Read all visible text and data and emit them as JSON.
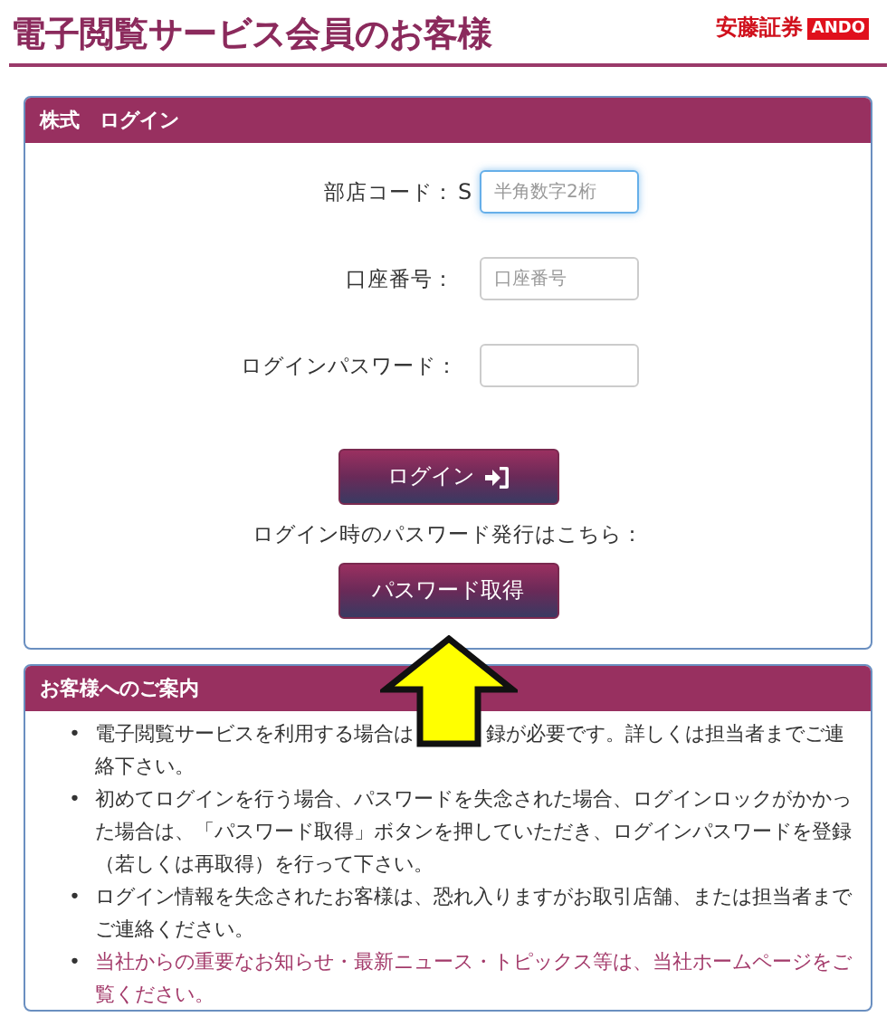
{
  "header": {
    "title": "電子閲覧サービス会員のお客様",
    "logo_text": "安藤証券",
    "logo_badge": "ANDO"
  },
  "login_panel": {
    "title": "株式　ログイン",
    "fields": [
      {
        "label": "部店コード：",
        "prefix": "S",
        "placeholder": "半角数字2桁",
        "focused": true
      },
      {
        "label": "口座番号：",
        "placeholder": "口座番号",
        "focused": false
      },
      {
        "label": "ログインパスワード：",
        "focused": false
      }
    ],
    "login_button": "ログイン",
    "password_note": "ログイン時のパスワード発行はこちら：",
    "password_button": "パスワード取得"
  },
  "notice_panel": {
    "title": "お客様へのご案内",
    "items": [
      {
        "kind": "text",
        "bullet": "•",
        "text": "電子閲覧サービスを利用する場合は",
        "text_after_arrow": "録が必要です。詳しくは担当者までご連",
        "text_continued": "絡下さい。"
      },
      {
        "kind": "text",
        "bullet": "•",
        "text": "初めてログインを行う場合、パスワードを失念された場合、ログインロックがかかった場合は、「パスワード取得」ボタンを押していただき、ログインパスワードを登録（若しくは再取得）を行って下さい。"
      },
      {
        "kind": "text",
        "bullet": "•",
        "text": "ログイン情報を失念されたお客様は、恐れ入りますがお取引店舗、または担当者までご連絡ください。"
      },
      {
        "kind": "link",
        "bullet": "•",
        "text": "当社からの重要なお知らせ・最新ニュース・トピックス等は、当社ホームページをご覧ください。"
      }
    ]
  }
}
